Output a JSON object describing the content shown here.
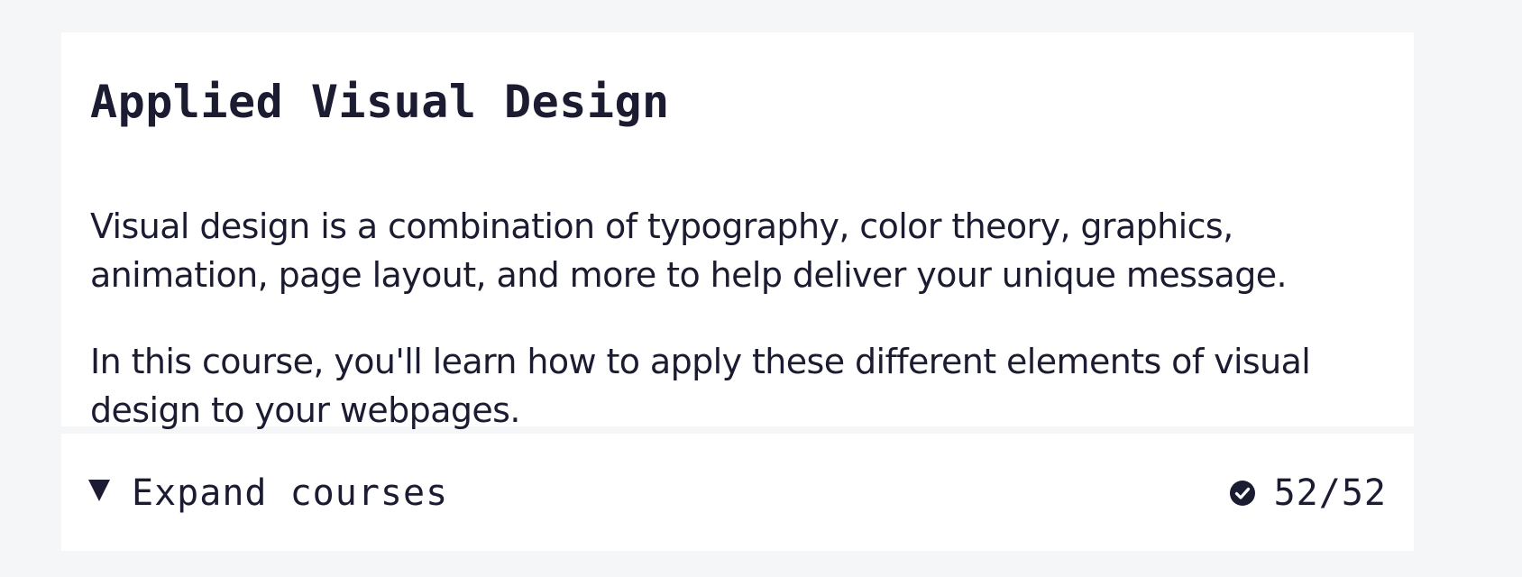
{
  "block": {
    "title": "Applied Visual Design",
    "description": [
      "Visual design is a combination of typography, color theory, graphics, animation, page layout, and more to help deliver your unique message.",
      "In this course, you'll learn how to apply these different elements of visual design to your webpages."
    ],
    "expand_label": "Expand courses",
    "expand_icon": "triangle-down-icon",
    "progress_icon": "check-circle-icon",
    "progress_text": "52/52",
    "progress": {
      "completed": 52,
      "total": 52
    }
  },
  "colors": {
    "page_background": "#f5f6f7",
    "card_background": "#ffffff",
    "text": "#1b1b32"
  }
}
